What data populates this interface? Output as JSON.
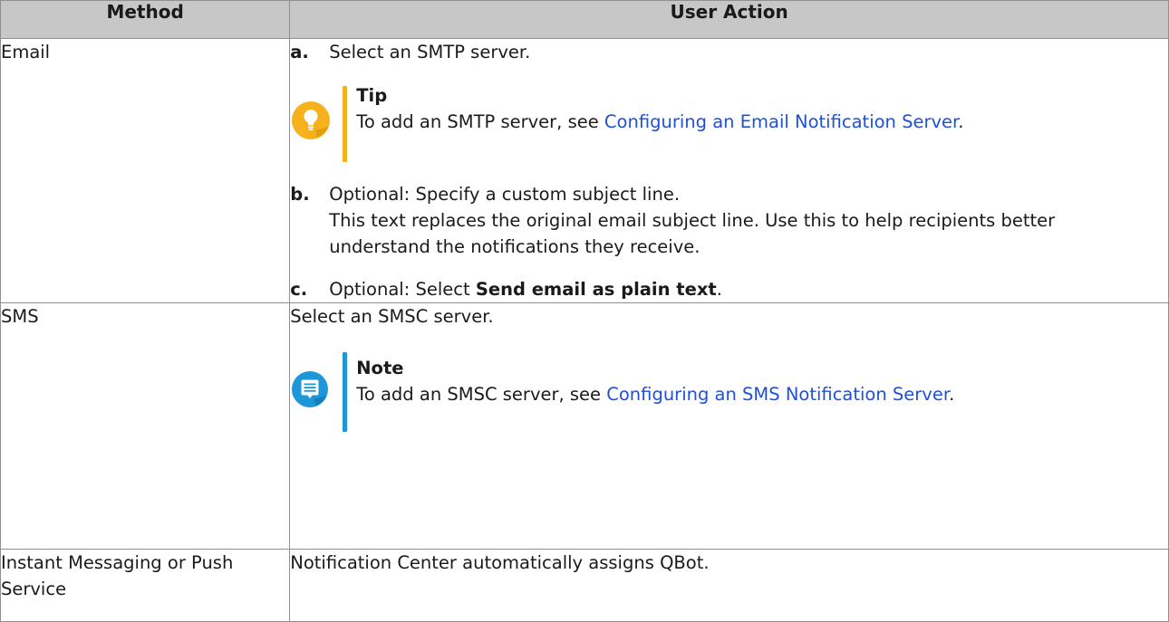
{
  "table": {
    "headers": [
      "Method",
      "User Action"
    ],
    "email": {
      "method": "Email",
      "step_a": {
        "letter": "a.",
        "text": "Select an SMTP server."
      },
      "tip": {
        "title": "Tip",
        "text_before": "To add an SMTP server, see ",
        "link": "Configuring an Email Notification Server",
        "text_after": "."
      },
      "step_b": {
        "letter": "b.",
        "text": "Optional: Specify a custom subject line.",
        "detail": "This text replaces the original email subject line. Use this to help recipients better understand the notifications they receive."
      },
      "step_c": {
        "letter": "c.",
        "text_before": "Optional: Select ",
        "bold": "Send email as plain text",
        "text_after": "."
      }
    },
    "sms": {
      "method": "SMS",
      "text": "Select an SMSC server.",
      "note": {
        "title": "Note",
        "text_before": "To add an SMSC server, see ",
        "link": "Configuring an SMS Notification Server",
        "text_after": "."
      }
    },
    "im": {
      "method": "Instant Messaging or Push Service",
      "text": "Notification Center automatically assigns QBot."
    }
  },
  "colors": {
    "header_bg": "#c7c7c7",
    "tip_accent": "#f5b21c",
    "note_accent": "#1e97d8",
    "link": "#1f50d6"
  },
  "icons": {
    "tip": "lightbulb-icon",
    "note": "note-icon"
  }
}
